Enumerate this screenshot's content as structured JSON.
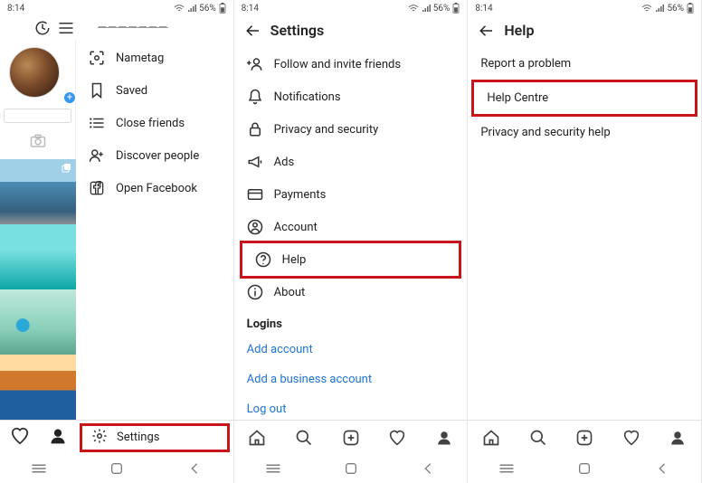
{
  "status": {
    "time": "8:14",
    "battery": "56%",
    "bt": true,
    "wifi": true,
    "signal": true
  },
  "panel1": {
    "username": "———————",
    "menu": [
      {
        "label": "Nametag"
      },
      {
        "label": "Saved"
      },
      {
        "label": "Close friends"
      },
      {
        "label": "Discover people"
      },
      {
        "label": "Open Facebook"
      }
    ],
    "settings_label": "Settings"
  },
  "panel2": {
    "title": "Settings",
    "items": [
      {
        "label": "Follow and invite friends"
      },
      {
        "label": "Notifications"
      },
      {
        "label": "Privacy and security"
      },
      {
        "label": "Ads"
      },
      {
        "label": "Payments"
      },
      {
        "label": "Account"
      },
      {
        "label": "Help",
        "hl": true
      },
      {
        "label": "About"
      }
    ],
    "logins_label": "Logins",
    "links": [
      "Add account",
      "Add a business account",
      "Log out"
    ]
  },
  "panel3": {
    "title": "Help",
    "items": [
      {
        "label": "Report a problem"
      },
      {
        "label": "Help Centre",
        "hl": true
      },
      {
        "label": "Privacy and security help"
      }
    ]
  }
}
